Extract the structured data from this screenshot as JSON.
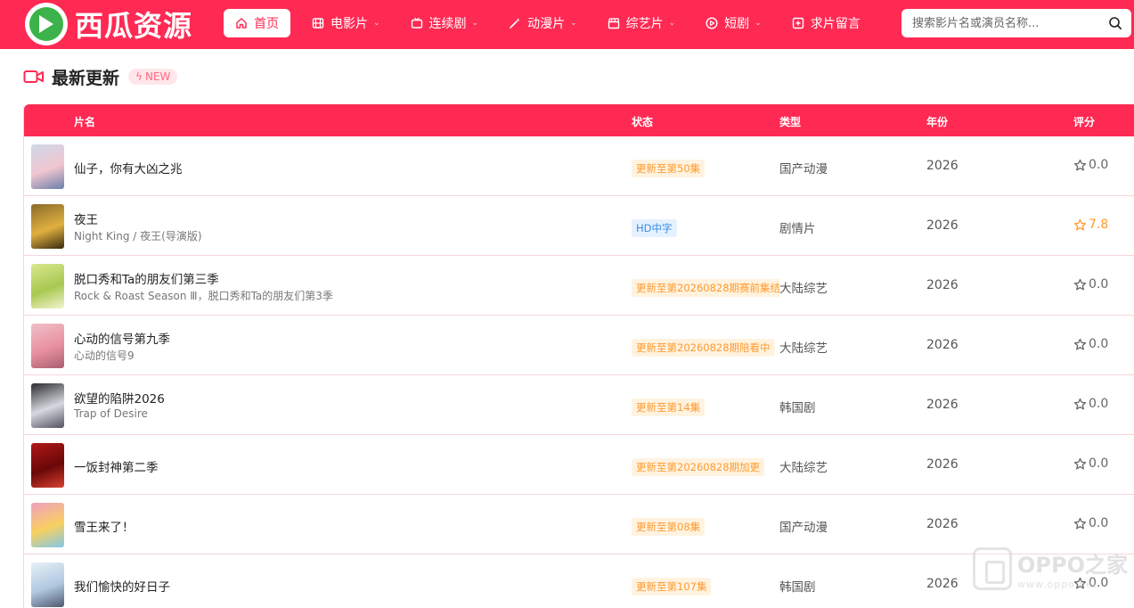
{
  "brand": {
    "name": "西瓜资源"
  },
  "nav": {
    "items": [
      {
        "label": "首页",
        "icon": "home-icon",
        "active": true
      },
      {
        "label": "电影片",
        "icon": "film-icon",
        "dropdown": true
      },
      {
        "label": "连续剧",
        "icon": "tv-icon",
        "dropdown": true
      },
      {
        "label": "动漫片",
        "icon": "magic-wand-icon",
        "dropdown": true
      },
      {
        "label": "综艺片",
        "icon": "clapperboard-icon",
        "dropdown": true
      },
      {
        "label": "短剧",
        "icon": "play-circle-icon",
        "dropdown": true
      },
      {
        "label": "求片留言",
        "icon": "message-plus-icon"
      }
    ]
  },
  "search": {
    "placeholder": "搜索影片名或演员名称..."
  },
  "section": {
    "title": "最新更新",
    "badge": "NEW"
  },
  "table": {
    "headers": {
      "name": "片名",
      "status": "状态",
      "genre": "类型",
      "year": "年份",
      "score": "评分"
    },
    "rows": [
      {
        "title": "仙子，你有大凶之兆",
        "subtitle": "",
        "status": "更新至第50集",
        "status_color": "orange",
        "genre": "国产动漫",
        "year": "2026",
        "score": "0.0",
        "poster_colors": [
          "#cfd8e8",
          "#f0c6d0",
          "#6a7fa8"
        ]
      },
      {
        "title": "夜王",
        "subtitle": "Night King / 夜王(导演版)",
        "status": "HD中字",
        "status_color": "blue",
        "genre": "剧情片",
        "year": "2026",
        "score": "7.8",
        "poster_colors": [
          "#8a6a2a",
          "#e0b040",
          "#3a2a10"
        ]
      },
      {
        "title": "脱口秀和Ta的朋友们第三季",
        "subtitle": "Rock & Roast Season Ⅲ，脱口秀和Ta的朋友们第3季",
        "status": "更新至第20260828期赛前集结",
        "status_color": "orange",
        "genre": "大陆综艺",
        "year": "2026",
        "score": "0.0",
        "poster_colors": [
          "#d8e890",
          "#a8c850",
          "#f4f4d0"
        ]
      },
      {
        "title": "心动的信号第九季",
        "subtitle": "心动的信号9",
        "status": "更新至第20260828期陪看中",
        "status_color": "orange",
        "genre": "大陆综艺",
        "year": "2026",
        "score": "0.0",
        "poster_colors": [
          "#f0c0c8",
          "#e890a0",
          "#a86070"
        ]
      },
      {
        "title": "欲望的陷阱2026",
        "subtitle": "Trap of Desire",
        "status": "更新至第14集",
        "status_color": "orange",
        "genre": "韩国剧",
        "year": "2026",
        "score": "0.0",
        "poster_colors": [
          "#2a2a30",
          "#d8d8e0",
          "#505060"
        ]
      },
      {
        "title": "一饭封神第二季",
        "subtitle": "",
        "status": "更新至第20260828期加更",
        "status_color": "orange",
        "genre": "大陆综艺",
        "year": "2026",
        "score": "0.0",
        "poster_colors": [
          "#b01818",
          "#6a0808",
          "#d84030"
        ]
      },
      {
        "title": "雪王来了！",
        "subtitle": "",
        "status": "更新至第08集",
        "status_color": "orange",
        "genre": "国产动漫",
        "year": "2026",
        "score": "0.0",
        "poster_colors": [
          "#f0a0c0",
          "#f8d060",
          "#80c8e8"
        ]
      },
      {
        "title": "我们愉快的好日子",
        "subtitle": "",
        "status": "更新至第107集",
        "status_color": "orange",
        "genre": "韩国剧",
        "year": "2026",
        "score": "0.0",
        "poster_colors": [
          "#e8f0f8",
          "#b0c8e0",
          "#505870"
        ]
      }
    ]
  },
  "watermark": {
    "title": "OPPO之家",
    "url": "www.oppo.net"
  },
  "colors": {
    "brand": "#ff2a54",
    "status_orange": "#ff9a2e",
    "status_blue": "#3a8ee6",
    "score_highlight": "#ff9a2e"
  }
}
